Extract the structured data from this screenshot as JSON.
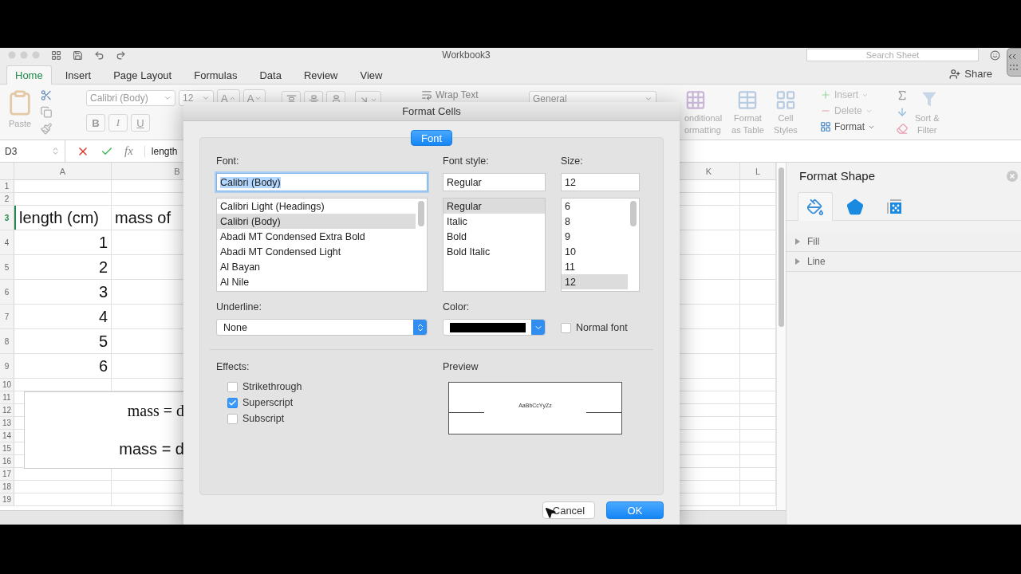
{
  "title_bar": {
    "title": "Workbook3",
    "search": {
      "placeholder": "Search Sheet"
    }
  },
  "ribbon_tabs": [
    {
      "label": "Home",
      "selected": true
    },
    {
      "label": "Insert",
      "selected": false
    },
    {
      "label": "Page Layout",
      "selected": false
    },
    {
      "label": "Formulas",
      "selected": false
    },
    {
      "label": "Data",
      "selected": false
    },
    {
      "label": "Review",
      "selected": false
    },
    {
      "label": "View",
      "selected": false
    }
  ],
  "share": "Share",
  "ribbon": {
    "paste": "Paste",
    "font_name": "Calibri (Body)",
    "font_size": "12",
    "grow_font": "A",
    "shrink_font": "A",
    "bold": "B",
    "italic": "I",
    "underline": "U",
    "wrap_text": "Wrap Text",
    "number_format": "General",
    "styles": [
      {
        "kind": "conditional",
        "lines": [
          "onditional",
          "ormatting"
        ]
      },
      {
        "kind": "table",
        "lines": [
          "Format",
          "as Table"
        ]
      },
      {
        "kind": "cell",
        "lines": [
          "Cell",
          "Styles"
        ]
      }
    ],
    "cells": [
      {
        "kind": "insert",
        "label": "Insert",
        "disabled": true
      },
      {
        "kind": "delete",
        "label": "Delete",
        "disabled": true
      },
      {
        "kind": "format",
        "label": "Format",
        "disabled": false
      }
    ],
    "sort_filter": [
      "Sort &",
      "Filter"
    ]
  },
  "formula_bar": {
    "name_box": "D3",
    "function_label": "fx",
    "content": "length"
  },
  "sheet": {
    "columns_left": [
      "A",
      "B"
    ],
    "columns_right": [
      "K",
      "L"
    ],
    "rows": [
      {
        "number": "1",
        "selected": false
      },
      {
        "number": "2",
        "selected": false
      },
      {
        "number": "3",
        "selected": true,
        "cells": [
          {
            "kind": "text",
            "text": "length (cm)"
          },
          {
            "kind": "text",
            "text": "mass of"
          }
        ]
      },
      {
        "number": "4",
        "selected": false,
        "cells": [
          {
            "kind": "number",
            "text": "1"
          }
        ]
      },
      {
        "number": "5",
        "selected": false,
        "cells": [
          {
            "kind": "number",
            "text": "2"
          }
        ]
      },
      {
        "number": "6",
        "selected": false,
        "cells": [
          {
            "kind": "number",
            "text": "3"
          }
        ]
      },
      {
        "number": "7",
        "selected": false,
        "cells": [
          {
            "kind": "number",
            "text": "4"
          }
        ]
      },
      {
        "number": "8",
        "selected": false,
        "cells": [
          {
            "kind": "number",
            "text": "5"
          }
        ]
      },
      {
        "number": "9",
        "selected": false,
        "cells": [
          {
            "kind": "number",
            "text": "6"
          }
        ]
      },
      {
        "number": "10",
        "selected": false
      },
      {
        "number": "11",
        "selected": false
      },
      {
        "number": "12",
        "selected": false
      },
      {
        "number": "13",
        "selected": false
      },
      {
        "number": "14",
        "selected": false
      },
      {
        "number": "15",
        "selected": false
      },
      {
        "number": "16",
        "selected": false
      },
      {
        "number": "17",
        "selected": false
      },
      {
        "number": "18",
        "selected": false
      },
      {
        "number": "19",
        "selected": false
      }
    ],
    "text_box": {
      "lines": [
        {
          "kind": "equation",
          "text": "mass = d"
        },
        {
          "kind": "text",
          "text": "mass = d"
        }
      ]
    }
  },
  "format_pane": {
    "title": "Format Shape",
    "tabs": [
      {
        "kind": "fill",
        "selected": true
      },
      {
        "kind": "effects",
        "selected": false
      },
      {
        "kind": "size",
        "selected": false
      }
    ],
    "sections": [
      {
        "label": "Fill",
        "expanded": false
      },
      {
        "label": "Line",
        "expanded": false
      }
    ]
  },
  "dialog": {
    "title": "Format Cells",
    "tabs": [
      {
        "label": "Font",
        "selected": true
      }
    ],
    "font": {
      "label": "Font:",
      "value": "Calibri (Body)",
      "options": [
        {
          "label": "Calibri Light (Headings)",
          "selected": false
        },
        {
          "label": "Calibri (Body)",
          "selected": true
        },
        {
          "label": "Abadi MT Condensed Extra Bold",
          "selected": false
        },
        {
          "label": "Abadi MT Condensed Light",
          "selected": false
        },
        {
          "label": "Al Bayan",
          "selected": false
        },
        {
          "label": "Al Nile",
          "selected": false
        }
      ]
    },
    "font_style": {
      "label": "Font style:",
      "value": "Regular",
      "options": [
        {
          "label": "Regular",
          "selected": true
        },
        {
          "label": "Italic",
          "selected": false
        },
        {
          "label": "Bold",
          "selected": false
        },
        {
          "label": "Bold Italic",
          "selected": false
        }
      ]
    },
    "size": {
      "label": "Size:",
      "value": "12",
      "options": [
        {
          "label": "6",
          "selected": false
        },
        {
          "label": "8",
          "selected": false
        },
        {
          "label": "9",
          "selected": false
        },
        {
          "label": "10",
          "selected": false
        },
        {
          "label": "11",
          "selected": false
        },
        {
          "label": "12",
          "selected": true
        }
      ]
    },
    "underline": {
      "label": "Underline:",
      "value": "None"
    },
    "color": {
      "label": "Color:"
    },
    "normal_font": {
      "label": "Normal font",
      "checked": false
    },
    "effects": {
      "label": "Effects:",
      "options": [
        {
          "label": "Strikethrough",
          "checked": false
        },
        {
          "label": "Superscript",
          "checked": true
        },
        {
          "label": "Subscript",
          "checked": false
        }
      ]
    },
    "preview": {
      "label": "Preview",
      "sample": "AaBbCcYyZz"
    },
    "buttons": [
      {
        "label": "Cancel",
        "kind": "secondary"
      },
      {
        "label": "OK",
        "kind": "primary"
      }
    ]
  }
}
